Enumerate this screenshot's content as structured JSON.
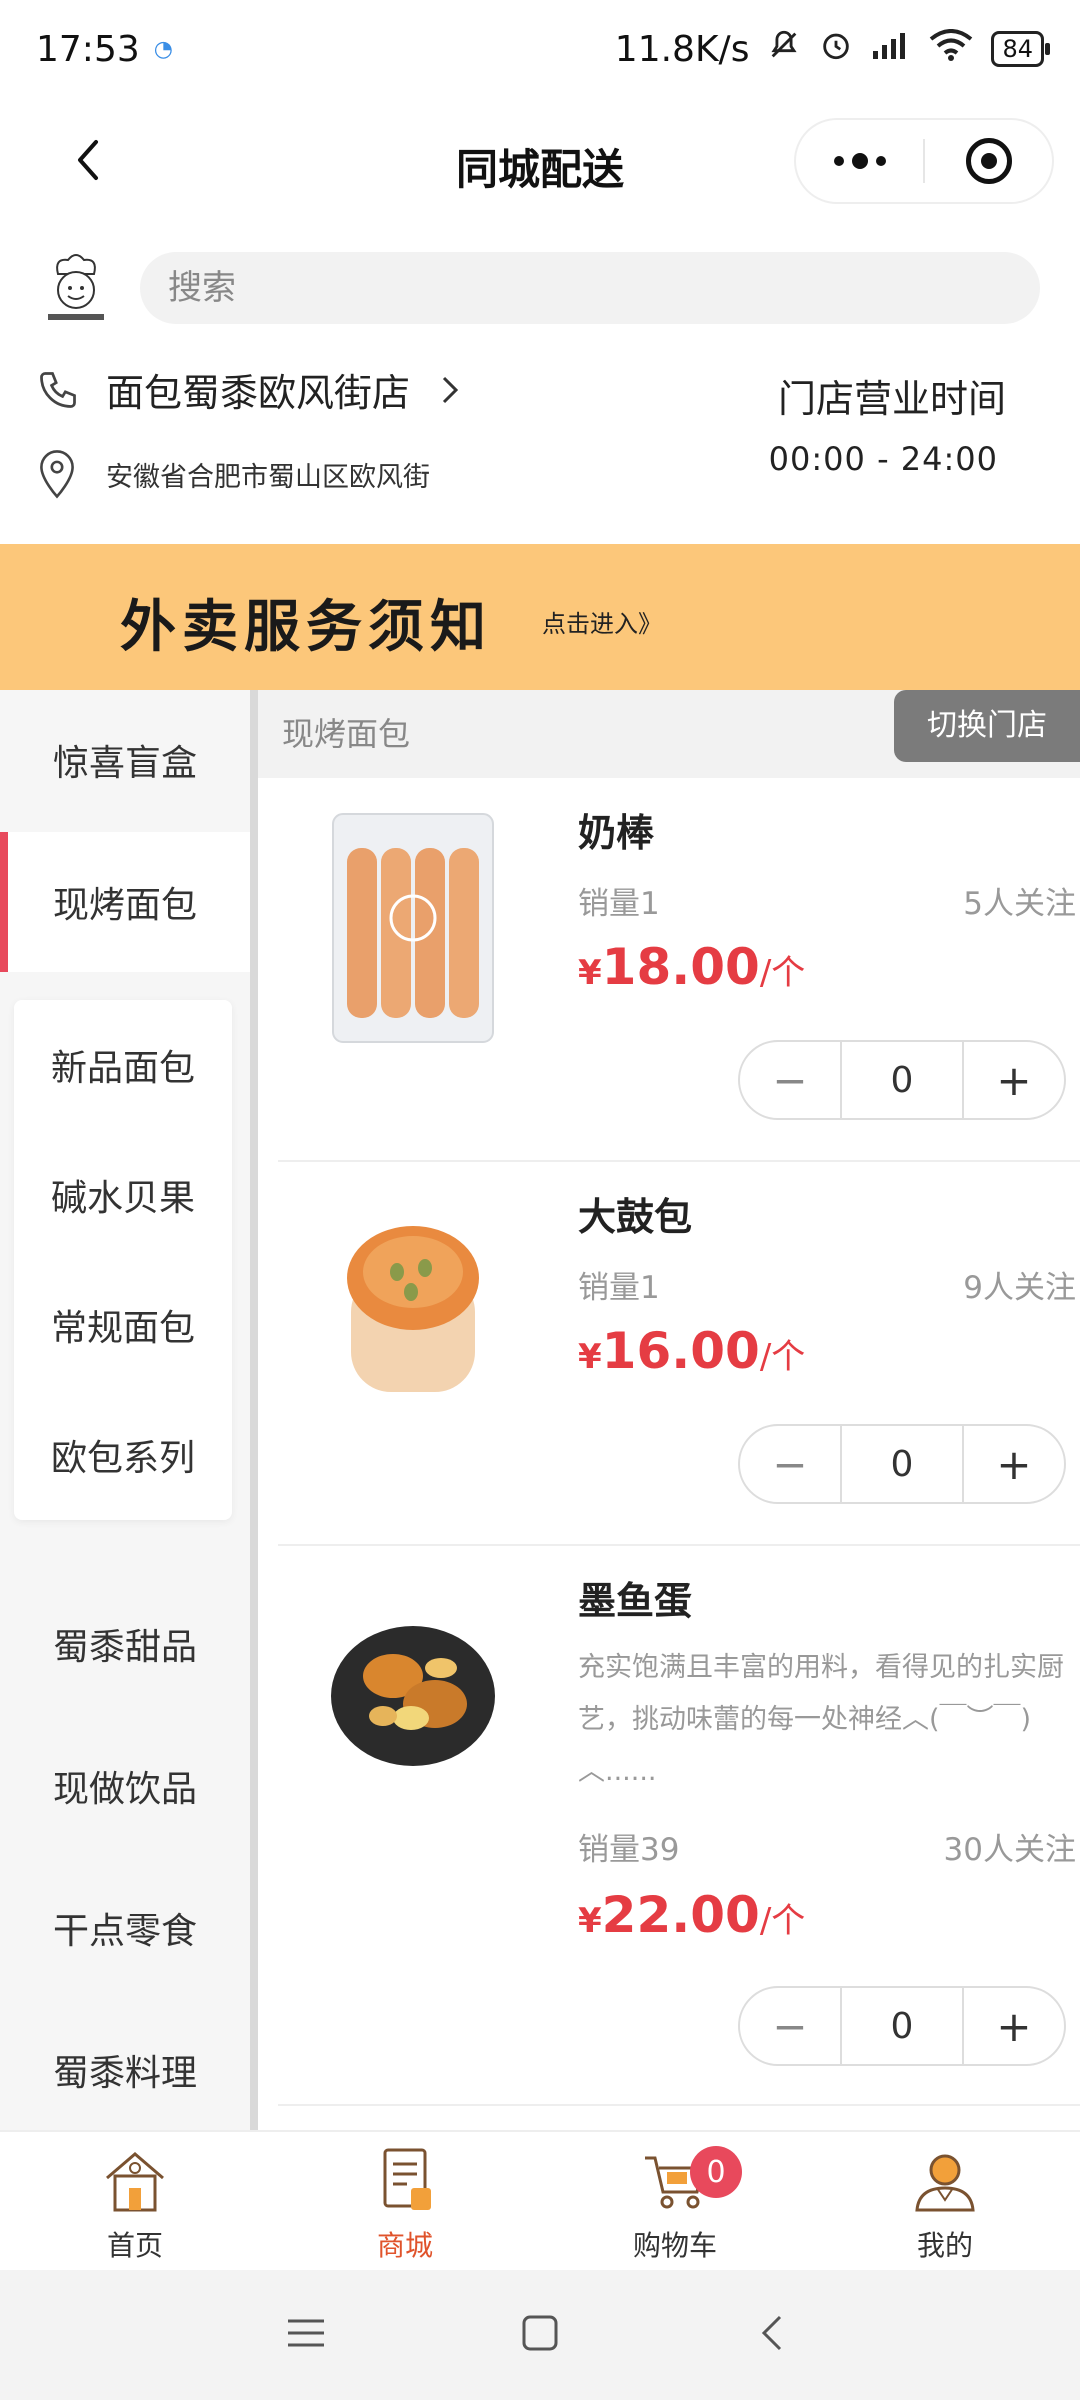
{
  "status_bar": {
    "time": "17:53",
    "network_speed": "11.8K/s",
    "battery": "84"
  },
  "header": {
    "title": "同城配送"
  },
  "search": {
    "placeholder": "搜索"
  },
  "store": {
    "name": "面包蜀黍欧风街店",
    "address": "安徽省合肥市蜀山区欧风街",
    "hours_label": "门店营业时间",
    "hours": "00:00 - 24:00"
  },
  "banner": {
    "title": "外卖服务须知",
    "link": "点击进入》"
  },
  "categories": {
    "top": [
      {
        "label": "惊喜盲盒"
      },
      {
        "label": "现烤面包"
      }
    ],
    "sub": [
      {
        "label": "新品面包"
      },
      {
        "label": "碱水贝果"
      },
      {
        "label": "常规面包"
      },
      {
        "label": "欧包系列"
      }
    ],
    "bottom": [
      {
        "label": "蜀黍甜品"
      },
      {
        "label": "现做饮品"
      },
      {
        "label": "干点零食"
      },
      {
        "label": "蜀黍料理"
      }
    ]
  },
  "section": {
    "title": "现烤面包",
    "switch_store": "切换门店"
  },
  "products": [
    {
      "name": "奶棒",
      "sales": "销量1",
      "follow": "5人关注",
      "currency": "¥",
      "price": "18.00",
      "unit": "/个",
      "qty": "0"
    },
    {
      "name": "大鼓包",
      "sales": "销量1",
      "follow": "9人关注",
      "currency": "¥",
      "price": "16.00",
      "unit": "/个",
      "qty": "0"
    },
    {
      "name": "墨鱼蛋",
      "desc": "充实饱满且丰富的用料，看得见的扎实厨艺，挑动味蕾的每一处神经︿(￣︶￣)︿......",
      "sales": "销量39",
      "follow": "30人关注",
      "currency": "¥",
      "price": "22.00",
      "unit": "/个",
      "qty": "0"
    }
  ],
  "tabbar": {
    "items": [
      {
        "label": "首页"
      },
      {
        "label": "商城"
      },
      {
        "label": "购物车"
      },
      {
        "label": "我的"
      }
    ],
    "cart_count": "0"
  },
  "colors": {
    "accent": "#e53c43",
    "banner": "#fcc77a",
    "active_tab": "#e0532b",
    "badge": "#e8495c"
  }
}
